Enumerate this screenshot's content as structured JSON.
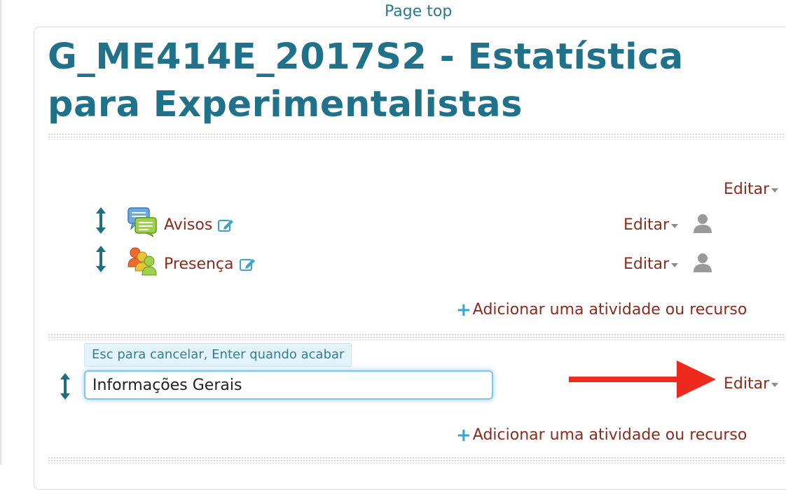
{
  "page_top": "Page top",
  "course": {
    "title": "G_ME414E_2017S2 - Estatística para Experimentalistas"
  },
  "section0": {
    "edit_menu": "Editar",
    "activities": [
      {
        "name": "Avisos",
        "icon": "forum-icon",
        "edit_menu": "Editar"
      },
      {
        "name": "Presença",
        "icon": "attendance-icon",
        "edit_menu": "Editar"
      }
    ],
    "add_activity": "Adicionar uma atividade ou recurso"
  },
  "section1": {
    "hint": "Esc para cancelar, Enter quando acabar",
    "title_value": "Informações Gerais",
    "edit_menu": "Editar",
    "add_activity": "Adicionar uma atividade ou recurso"
  },
  "colors": {
    "title": "#1f7289",
    "link": "#8b2b1d",
    "accent": "#35a4d0",
    "arrow": "#ee2a1f"
  }
}
